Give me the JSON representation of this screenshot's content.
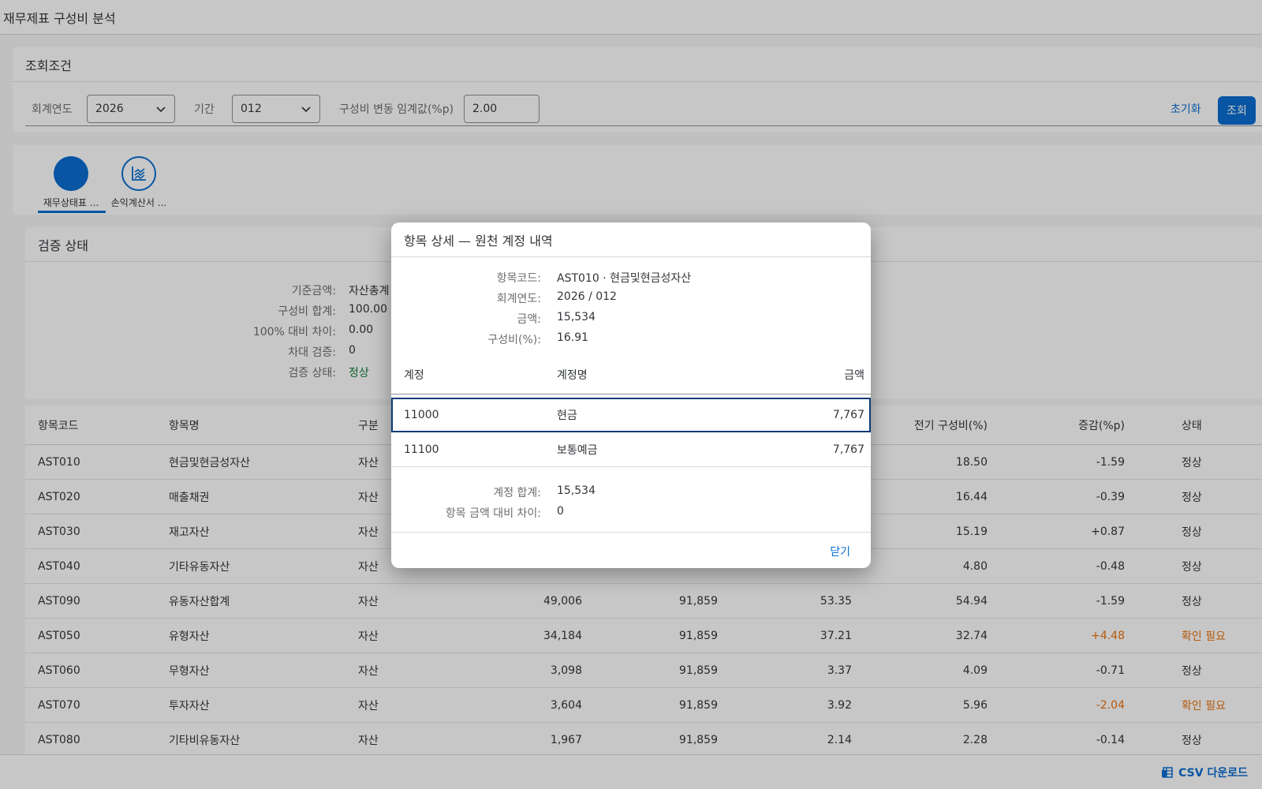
{
  "app": {
    "title": "재무제표 구성비 분석"
  },
  "filters": {
    "header": "조회조건",
    "year_label": "회계연도",
    "year_value": "2026",
    "period_label": "기간",
    "period_value": "012",
    "threshold_label": "구성비 변동 임계값(%p)",
    "threshold_value": "2.00",
    "reset_label": "초기화",
    "search_label": "조회"
  },
  "tabs": [
    {
      "label": "재무상태표 ...",
      "icon": "circle-icon",
      "selected": true
    },
    {
      "label": "손익계산서 ...",
      "icon": "line-chart-icon",
      "selected": false
    }
  ],
  "validation": {
    "header": "검증 상태",
    "items": [
      {
        "key": "기준금액:",
        "value": "자산총계"
      },
      {
        "key": "구성비 합계:",
        "value": "100.00"
      },
      {
        "key": "100% 대비 차이:",
        "value": "0.00"
      },
      {
        "key": "차대 검증:",
        "value": "0"
      },
      {
        "key": "검증 상태:",
        "value": "정상"
      }
    ]
  },
  "table": {
    "columns": [
      "항목코드",
      "항목명",
      "구분",
      "전기 구성비(%)",
      "증감(%p)",
      "상태"
    ],
    "rows": [
      {
        "code": "AST010",
        "name": "현금및현금성자산",
        "type": "자산",
        "amount": "",
        "base": "",
        "ratio": "",
        "prev": "18.50",
        "diff": "-1.59",
        "status": "정상",
        "warn": false
      },
      {
        "code": "AST020",
        "name": "매출채권",
        "type": "자산",
        "amount": "",
        "base": "",
        "ratio": "",
        "prev": "16.44",
        "diff": "-0.39",
        "status": "정상",
        "warn": false
      },
      {
        "code": "AST030",
        "name": "재고자산",
        "type": "자산",
        "amount": "",
        "base": "",
        "ratio": "",
        "prev": "15.19",
        "diff": "+0.87",
        "status": "정상",
        "warn": false
      },
      {
        "code": "AST040",
        "name": "기타유동자산",
        "type": "자산",
        "amount": "",
        "base": "",
        "ratio": "",
        "prev": "4.80",
        "diff": "-0.48",
        "status": "정상",
        "warn": false
      },
      {
        "code": "AST090",
        "name": "유동자산합계",
        "type": "자산",
        "amount": "49,006",
        "base": "91,859",
        "ratio": "53.35",
        "prev": "54.94",
        "diff": "-1.59",
        "status": "정상",
        "warn": false
      },
      {
        "code": "AST050",
        "name": "유형자산",
        "type": "자산",
        "amount": "34,184",
        "base": "91,859",
        "ratio": "37.21",
        "prev": "32.74",
        "diff": "+4.48",
        "status": "확인 필요",
        "warn": true
      },
      {
        "code": "AST060",
        "name": "무형자산",
        "type": "자산",
        "amount": "3,098",
        "base": "91,859",
        "ratio": "3.37",
        "prev": "4.09",
        "diff": "-0.71",
        "status": "정상",
        "warn": false
      },
      {
        "code": "AST070",
        "name": "투자자산",
        "type": "자산",
        "amount": "3,604",
        "base": "91,859",
        "ratio": "3.92",
        "prev": "5.96",
        "diff": "-2.04",
        "status": "확인 필요",
        "warn": true
      },
      {
        "code": "AST080",
        "name": "기타비유동자산",
        "type": "자산",
        "amount": "1,967",
        "base": "91,859",
        "ratio": "2.14",
        "prev": "2.28",
        "diff": "-0.14",
        "status": "정상",
        "warn": false
      }
    ]
  },
  "footer": {
    "csv_label": "CSV 다운로드"
  },
  "dialog": {
    "title": "항목 상세 — 원천 계정 내역",
    "info": [
      {
        "key": "항목코드:",
        "value": "AST010 · 현금및현금성자산"
      },
      {
        "key": "회계연도:",
        "value": "2026 / 012"
      },
      {
        "key": "금액:",
        "value": "15,534"
      },
      {
        "key": "구성비(%):",
        "value": "16.91"
      }
    ],
    "columns": [
      "계정",
      "계정명",
      "금액"
    ],
    "rows": [
      {
        "account": "11000",
        "name": "현금",
        "amount": "7,767",
        "selected": true
      },
      {
        "account": "11100",
        "name": "보통예금",
        "amount": "7,767",
        "selected": false
      }
    ],
    "summary": [
      {
        "key": "계정 합계:",
        "value": "15,534"
      },
      {
        "key": "항목 금액 대비 차이:",
        "value": "0"
      }
    ],
    "close_label": "닫기"
  },
  "colors": {
    "accent": "#0a6ed1",
    "ok": "#107e3e",
    "warn": "#e9730c"
  }
}
